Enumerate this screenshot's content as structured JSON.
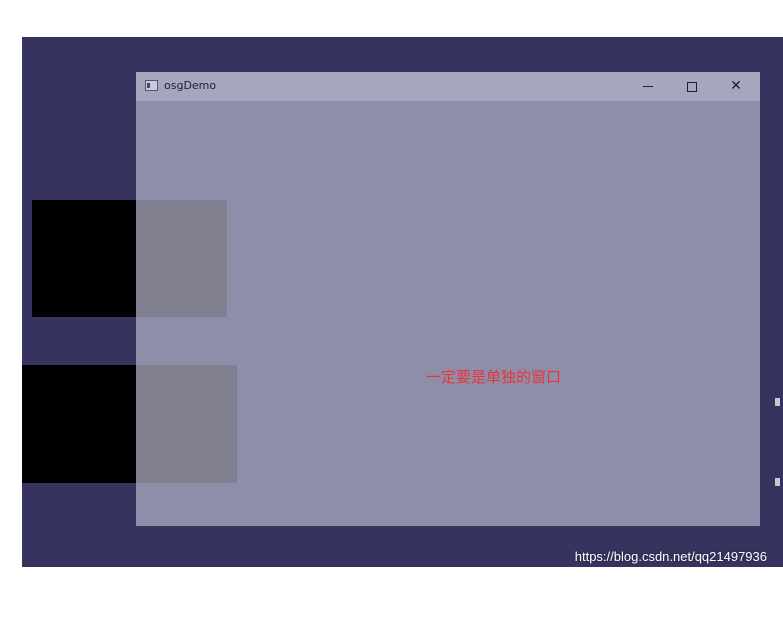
{
  "window": {
    "title": "osgDemo",
    "controls": {
      "minimize_icon": "minimize-icon",
      "maximize_icon": "maximize-icon",
      "close_icon": "close-icon",
      "close_glyph": "✕"
    }
  },
  "content": {
    "overlay_text": "一定要是单独的窗口"
  },
  "watermark": {
    "text": "https://blog.csdn.net/qq21497936"
  },
  "colors": {
    "desktop_background": "#36335f",
    "window_tint": "#b1b1c7",
    "overlay_text": "#e8353a",
    "black_rectangle": "#000000"
  }
}
